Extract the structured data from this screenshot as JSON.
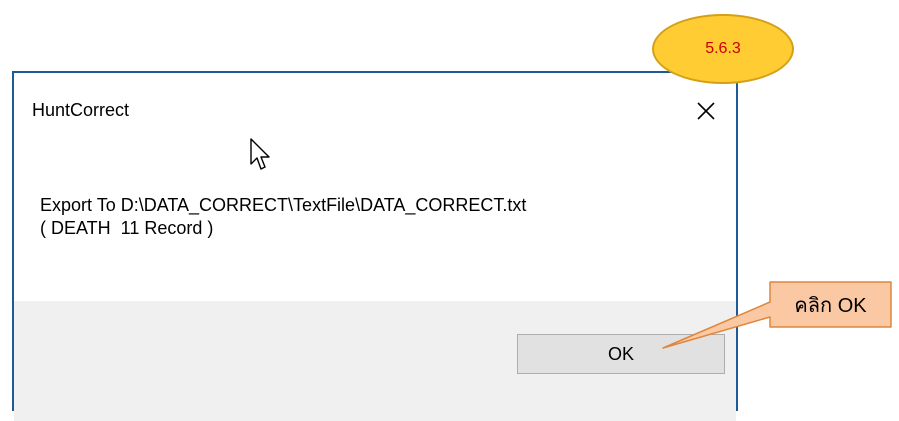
{
  "dialog": {
    "title": "HuntCorrect",
    "message_line1": "Export To D:\\DATA_CORRECT\\TextFile\\DATA_CORRECT.txt",
    "message_line2": "( DEATH  11 Record )",
    "ok_label": "OK",
    "close_symbol": "×"
  },
  "annotations": {
    "step_label": "5.6.3",
    "callout_label": "คลิก OK"
  },
  "icons": {
    "close": "close-icon",
    "cursor": "mouse-cursor-icon"
  },
  "colors": {
    "window_border": "#1e5a98",
    "footer_bg": "#f0f0f0",
    "button_bg": "#e1e1e1",
    "badge_fill": "#ffcc33",
    "badge_text": "#cc0000",
    "callout_fill": "#fbc8a4",
    "callout_border": "#e0863c"
  }
}
